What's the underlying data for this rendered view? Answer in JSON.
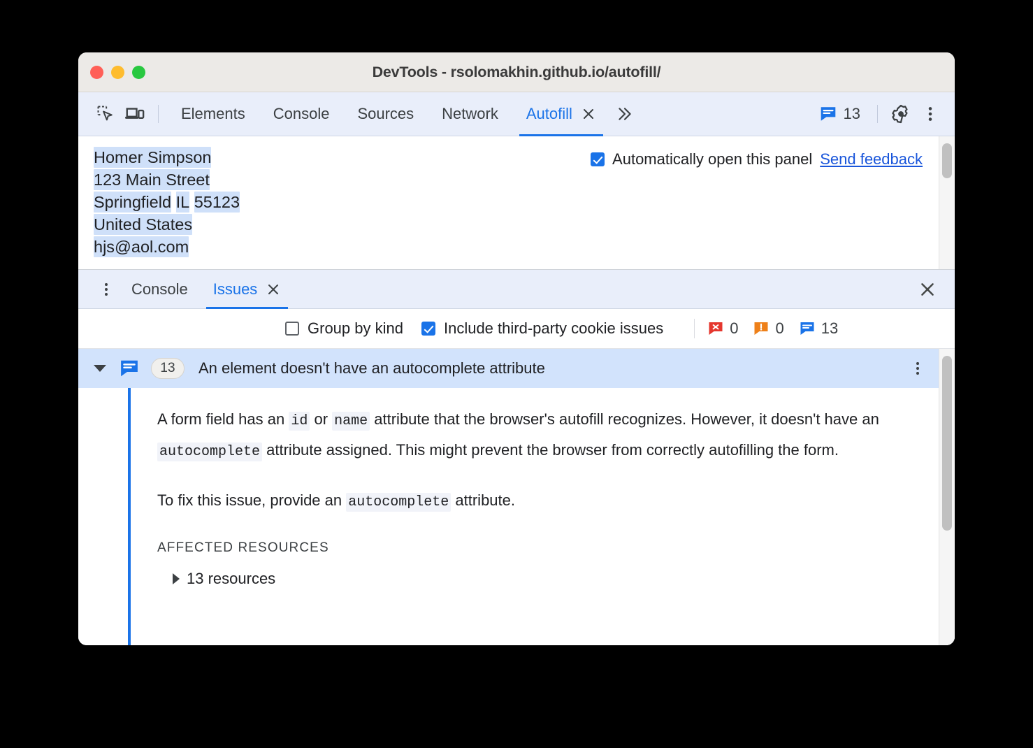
{
  "window": {
    "title": "DevTools - rsolomakhin.github.io/autofill/",
    "controls": [
      "close",
      "minimize",
      "maximize"
    ]
  },
  "devtools_tabbar": {
    "inspect_icon": "inspect-element-icon",
    "device_icon": "device-toolbar-icon",
    "tabs": [
      {
        "label": "Elements",
        "active": false,
        "closable": false
      },
      {
        "label": "Console",
        "active": false,
        "closable": false
      },
      {
        "label": "Sources",
        "active": false,
        "closable": false
      },
      {
        "label": "Network",
        "active": false,
        "closable": false
      },
      {
        "label": "Autofill",
        "active": true,
        "closable": true
      }
    ],
    "more_tabs_label": "»",
    "issues_count": "13",
    "settings_icon": "gear-icon",
    "more_icon": "kebab-menu-icon"
  },
  "autofill_panel": {
    "address_lines": [
      [
        {
          "text": "Homer Simpson",
          "highlighted": true
        }
      ],
      [
        {
          "text": "123 Main Street",
          "highlighted": true
        }
      ],
      [
        {
          "text": "Springfield",
          "highlighted": true
        },
        {
          "text": " ",
          "highlighted": false
        },
        {
          "text": "IL",
          "highlighted": true
        },
        {
          "text": " ",
          "highlighted": false
        },
        {
          "text": "55123",
          "highlighted": true
        }
      ],
      [
        {
          "text": "United States",
          "highlighted": true
        }
      ],
      [
        {
          "text": "hjs@aol.com",
          "highlighted": true
        }
      ]
    ],
    "auto_open_label": "Automatically open this panel",
    "auto_open_checked": true,
    "send_feedback_label": "Send feedback"
  },
  "drawer": {
    "menu_icon": "kebab-menu-icon",
    "tabs": [
      {
        "label": "Console",
        "active": false,
        "closable": false
      },
      {
        "label": "Issues",
        "active": true,
        "closable": true
      }
    ],
    "close_label": "✕"
  },
  "issues_toolbar": {
    "group_by_kind_label": "Group by kind",
    "group_by_kind_checked": false,
    "third_party_label": "Include third-party cookie issues",
    "third_party_checked": true,
    "counts": [
      {
        "kind": "error",
        "icon": "error-badge-icon",
        "value": "0",
        "color": "#e5372e"
      },
      {
        "kind": "warning",
        "icon": "warning-badge-icon",
        "value": "0",
        "color": "#f29900"
      },
      {
        "kind": "info",
        "icon": "info-badge-icon",
        "value": "13",
        "color": "#1a73e8"
      }
    ]
  },
  "issue": {
    "expanded": true,
    "icon": "info-badge-icon",
    "count_badge": "13",
    "title": "An element doesn't have an autocomplete attribute",
    "menu_icon": "kebab-menu-icon",
    "paragraph1": {
      "part1": "A form field has an ",
      "code1": "id",
      "part2": " or ",
      "code2": "name",
      "part3": " attribute that the browser's autofill recognizes. However, it doesn't have an ",
      "code3": "autocomplete",
      "part4": " attribute assigned. This might prevent the browser from correctly autofilling the form."
    },
    "paragraph2": {
      "part1": "To fix this issue, provide an ",
      "code1": "autocomplete",
      "part2": " attribute."
    },
    "affected_resources_label": "AFFECTED RESOURCES",
    "resources_label": "13 resources"
  },
  "colors": {
    "accent": "#1a73e8",
    "tabbar_bg": "#e9eefa",
    "highlight": "#cfe0f9",
    "issue_row_bg": "#d2e3fc",
    "titlebar_bg": "#eceae7"
  }
}
